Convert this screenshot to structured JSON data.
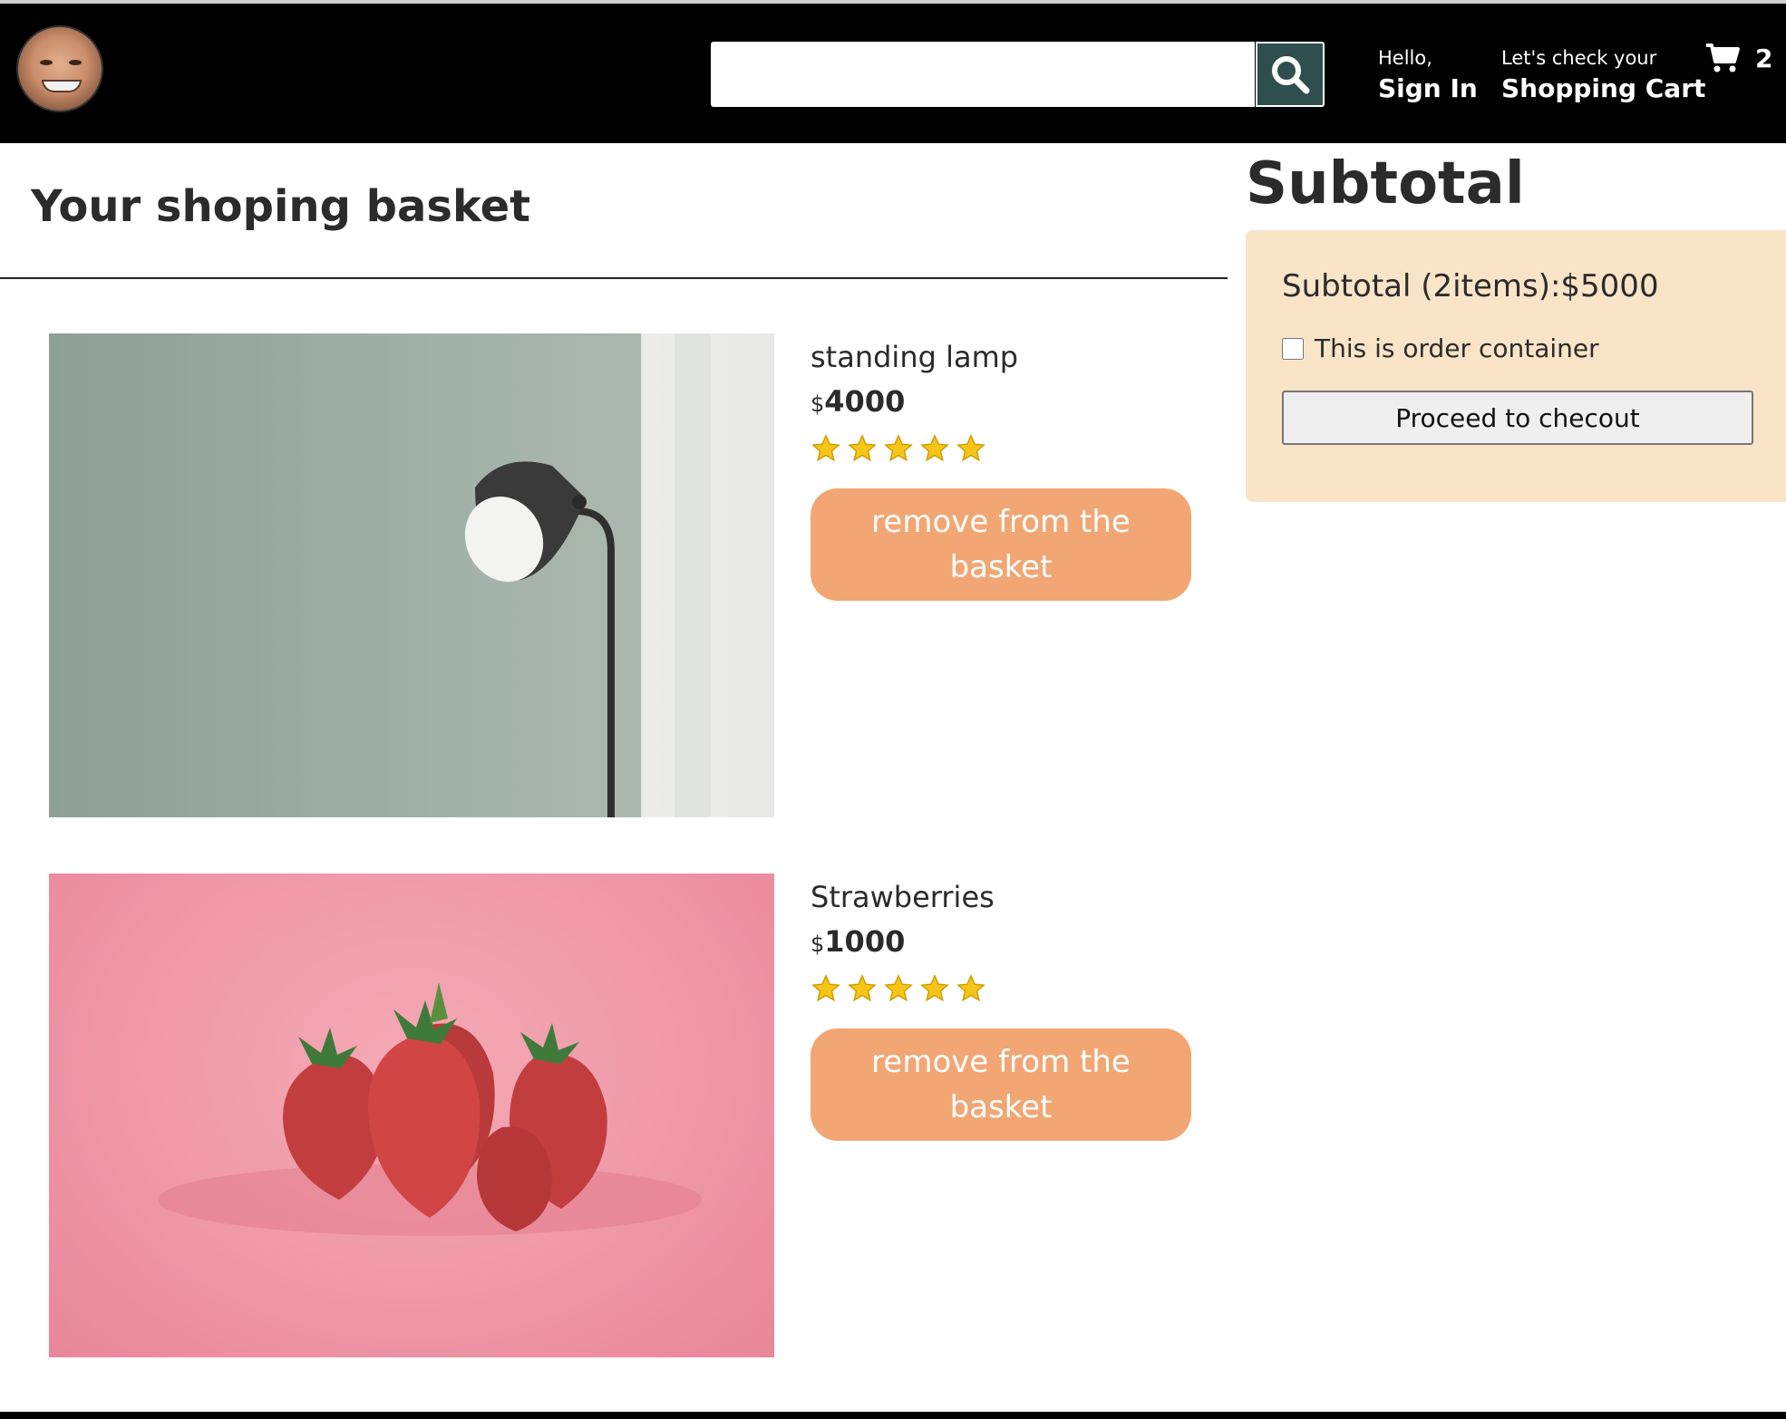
{
  "header": {
    "avatar_alt": "logo",
    "search": {
      "value": "",
      "placeholder": ""
    },
    "greeting": {
      "line1": "Hello,",
      "line2": "Sign In"
    },
    "cart_link": {
      "line1": "Let's check your",
      "line2": "Shopping Cart"
    },
    "basket_count": "2"
  },
  "page": {
    "title": "Your shoping basket"
  },
  "products": [
    {
      "title": "standing lamp",
      "currency": "$",
      "price": "4000",
      "rating": 5,
      "remove_label": "remove from the basket"
    },
    {
      "title": "Strawberries",
      "currency": "$",
      "price": "1000",
      "rating": 5,
      "remove_label": "remove from the basket"
    }
  ],
  "subtotal": {
    "heading": "Subtotal",
    "summary": "Subtotal (2items):$5000",
    "gift_label": "This is order container",
    "gift_checked": false,
    "checkout_label": "Proceed to checout"
  },
  "colors": {
    "header_bg": "#000000",
    "search_button": "#2f4f4f",
    "remove_button": "#f2a673",
    "subtotal_bg": "#f9e4c8",
    "star": "#f5c518"
  }
}
